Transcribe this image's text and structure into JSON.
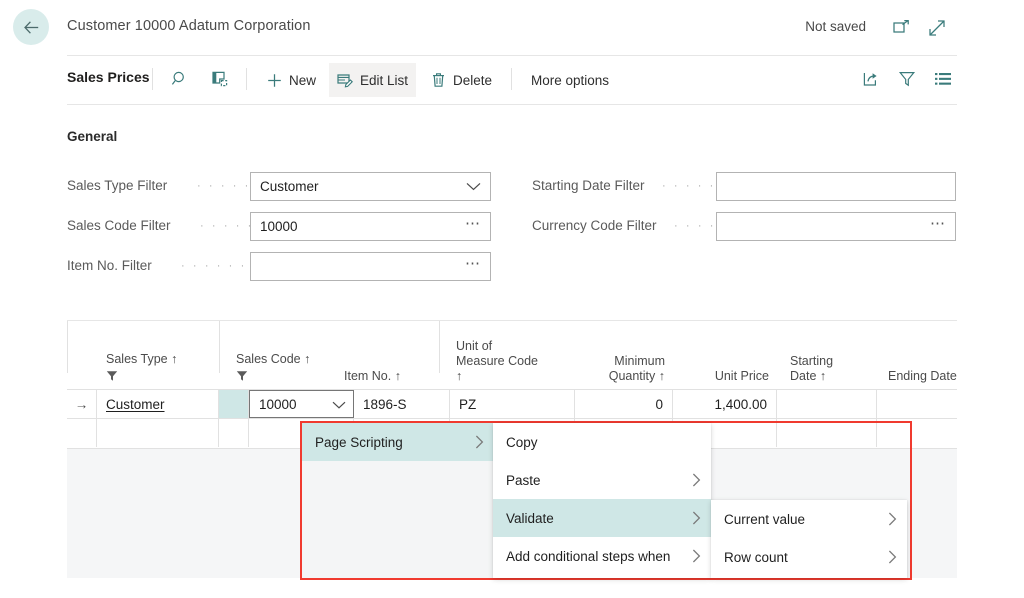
{
  "window": {
    "back_label": "back-arrow",
    "title": "Customer 10000 Adatum Corporation",
    "save_status": "Not saved"
  },
  "command_bar": {
    "page_name": "Sales Prices",
    "search_icon": "search-icon",
    "open_in_excel_icon": "open-in-new-window-icon",
    "items": [
      {
        "label": "New",
        "icon": "plus-icon"
      },
      {
        "label": "Edit List",
        "icon": "edit-list-icon"
      },
      {
        "label": "Delete",
        "icon": "trash-icon"
      },
      {
        "label": "More options",
        "icon": ""
      }
    ],
    "right_icons": [
      {
        "name": "share-icon"
      },
      {
        "name": "filter-icon"
      },
      {
        "name": "list-view-icon"
      }
    ]
  },
  "general": {
    "section_title": "General",
    "left_fields": [
      {
        "label": "Sales Type Filter",
        "value": "Customer",
        "affix": "chevron-down"
      },
      {
        "label": "Sales Code Filter",
        "value": "10000",
        "affix": "ellipsis"
      },
      {
        "label": "Item No. Filter",
        "value": "",
        "affix": "ellipsis"
      }
    ],
    "right_fields": [
      {
        "label": "Starting Date Filter",
        "value": "",
        "affix": "none"
      },
      {
        "label": "Currency Code Filter",
        "value": "",
        "affix": "ellipsis"
      }
    ]
  },
  "grid": {
    "columns": [
      {
        "label": "Sales Type ↑",
        "align": "l",
        "filter": true
      },
      {
        "label": "Sales Code ↑",
        "align": "l",
        "filter": true
      },
      {
        "label": "Item No. ↑",
        "align": "l",
        "filter": false
      },
      {
        "label": "Unit of\nMeasure Code\n↑",
        "align": "l",
        "filter": false
      },
      {
        "label": "Minimum\nQuantity ↑",
        "align": "r",
        "filter": false
      },
      {
        "label": "Unit Price",
        "align": "r",
        "filter": false
      },
      {
        "label": "Starting\nDate ↑",
        "align": "l",
        "filter": false
      },
      {
        "label": "Ending Date",
        "align": "l",
        "filter": false
      }
    ],
    "rows": [
      {
        "row_indicator": "→",
        "sales_type": "Customer",
        "sales_code": "10000",
        "item_no": "1896-S",
        "unit_of_measure_code": "PZ",
        "minimum_quantity": "0",
        "unit_price": "1,400.00",
        "starting_date": "",
        "ending_date": ""
      },
      {
        "row_indicator": "",
        "sales_type": "",
        "sales_code": "",
        "item_no": "",
        "unit_of_measure_code": "",
        "minimum_quantity": "",
        "unit_price": "",
        "starting_date": "",
        "ending_date": ""
      }
    ]
  },
  "context_menu": {
    "level1": [
      {
        "label": "Page Scripting",
        "has_submenu": true,
        "selected": true
      }
    ],
    "level2": [
      {
        "label": "Copy",
        "has_submenu": false,
        "selected": false
      },
      {
        "label": "Paste",
        "has_submenu": true,
        "selected": false
      },
      {
        "label": "Validate",
        "has_submenu": true,
        "selected": true
      },
      {
        "label": "Add conditional steps when",
        "has_submenu": true,
        "selected": false
      }
    ],
    "level3": [
      {
        "label": "Current value",
        "has_submenu": true,
        "selected": false
      },
      {
        "label": "Row count",
        "has_submenu": true,
        "selected": false
      }
    ]
  },
  "colors": {
    "accent_teal": "#3a7b7b",
    "highlight_teal": "#cfe7e6",
    "highlight_red": "#f03a2f",
    "back_circle": "#d9eceb"
  }
}
